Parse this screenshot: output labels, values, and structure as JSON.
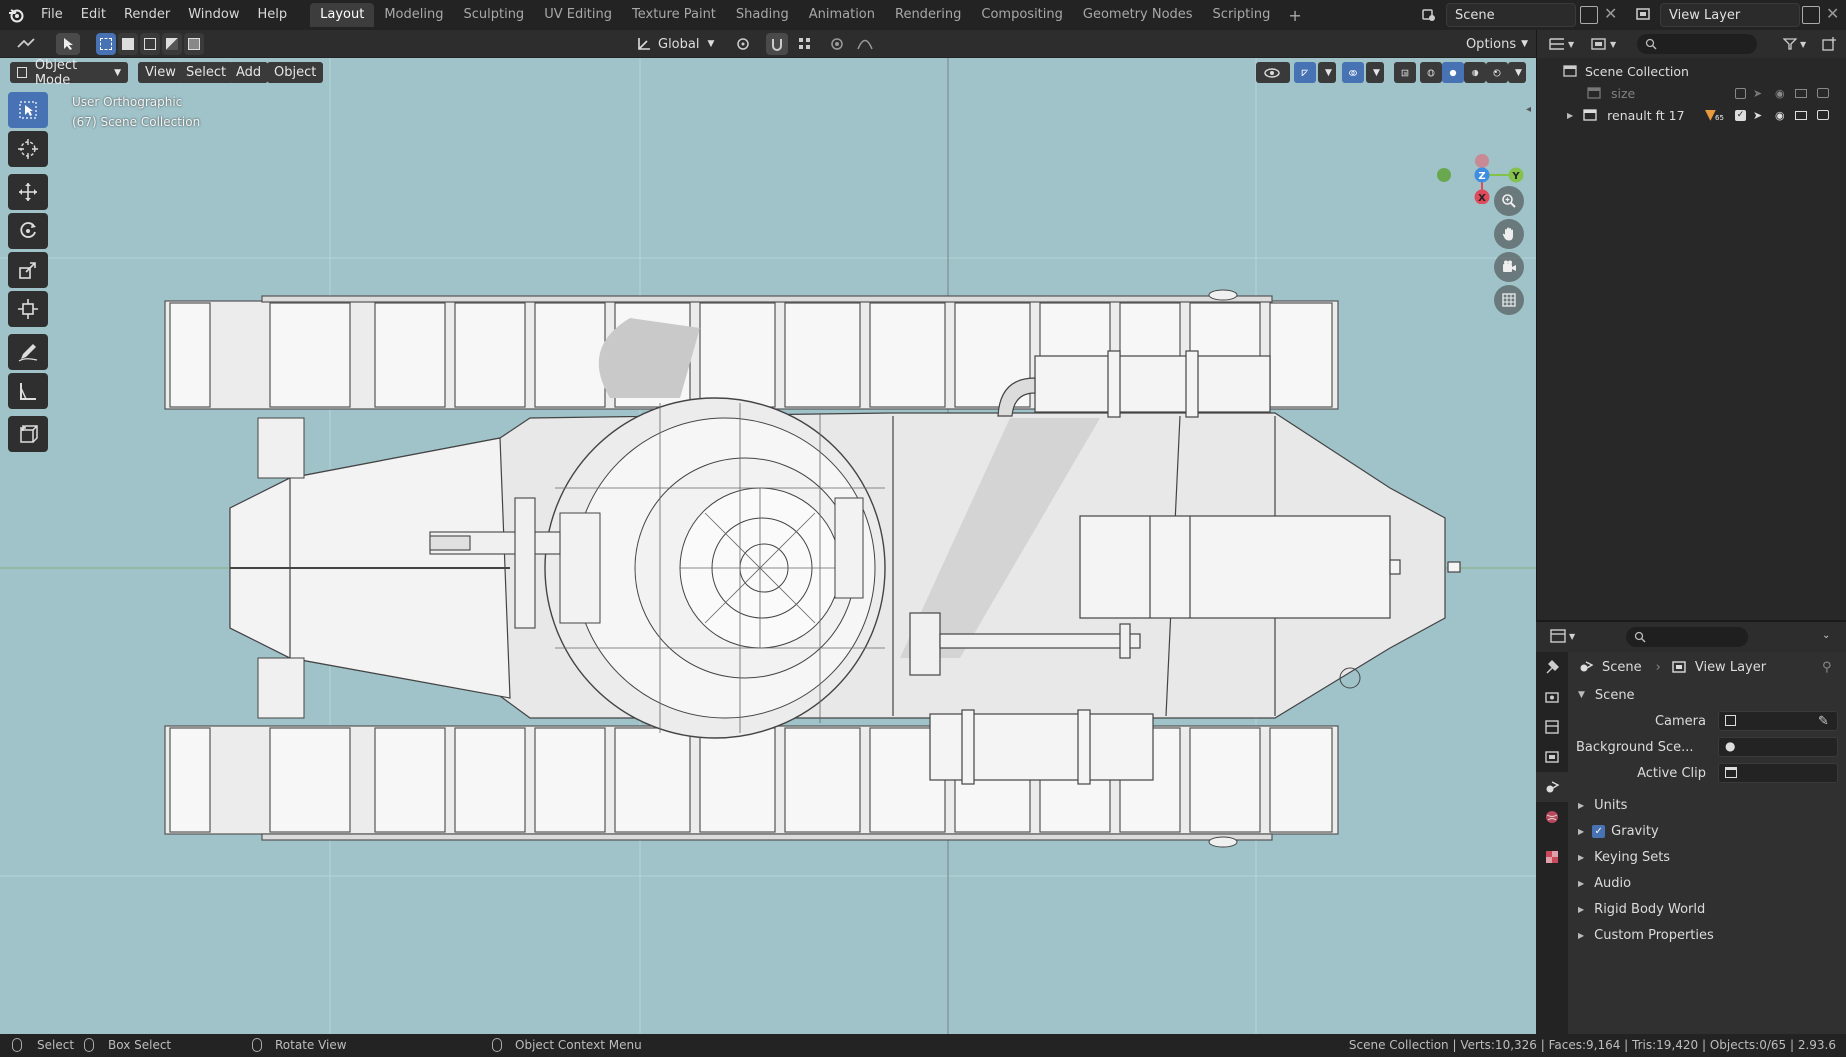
{
  "menu": [
    "File",
    "Edit",
    "Render",
    "Window",
    "Help"
  ],
  "workspaces": [
    "Layout",
    "Modeling",
    "Sculpting",
    "UV Editing",
    "Texture Paint",
    "Shading",
    "Animation",
    "Rendering",
    "Compositing",
    "Geometry Nodes",
    "Scripting"
  ],
  "active_workspace": "Layout",
  "scene_name": "Scene",
  "view_layer_name": "View Layer",
  "toolbar": {
    "orientation": "Global",
    "options": "Options"
  },
  "viewport": {
    "mode": "Object Mode",
    "menus": [
      "View",
      "Select",
      "Add",
      "Object"
    ],
    "view_name": "User Orthographic",
    "collection_info": "(67) Scene Collection",
    "background": "#9fc3c9"
  },
  "gizmo": {
    "x": "X",
    "y": "Y",
    "z": "Z"
  },
  "outliner": {
    "root": "Scene Collection",
    "items": [
      {
        "name": "size",
        "dimmed": true
      },
      {
        "name": "renault ft 17",
        "dimmed": false,
        "badge": "65"
      }
    ]
  },
  "properties": {
    "breadcrumb_scene": "Scene",
    "breadcrumb_layer": "View Layer",
    "section": "Scene",
    "fields": [
      {
        "label": "Camera"
      },
      {
        "label": "Background Sce..."
      },
      {
        "label": "Active Clip"
      }
    ],
    "panels": [
      "Units",
      "Gravity",
      "Keying Sets",
      "Audio",
      "Rigid Body World",
      "Custom Properties"
    ],
    "gravity_checked": true
  },
  "statusbar": {
    "select": "Select",
    "box_select": "Box Select",
    "rotate_view": "Rotate View",
    "context_menu": "Object Context Menu",
    "stats": "Scene Collection | Verts:10,326 | Faces:9,164 | Tris:19,420 | Objects:0/65 | 2.93.6"
  }
}
